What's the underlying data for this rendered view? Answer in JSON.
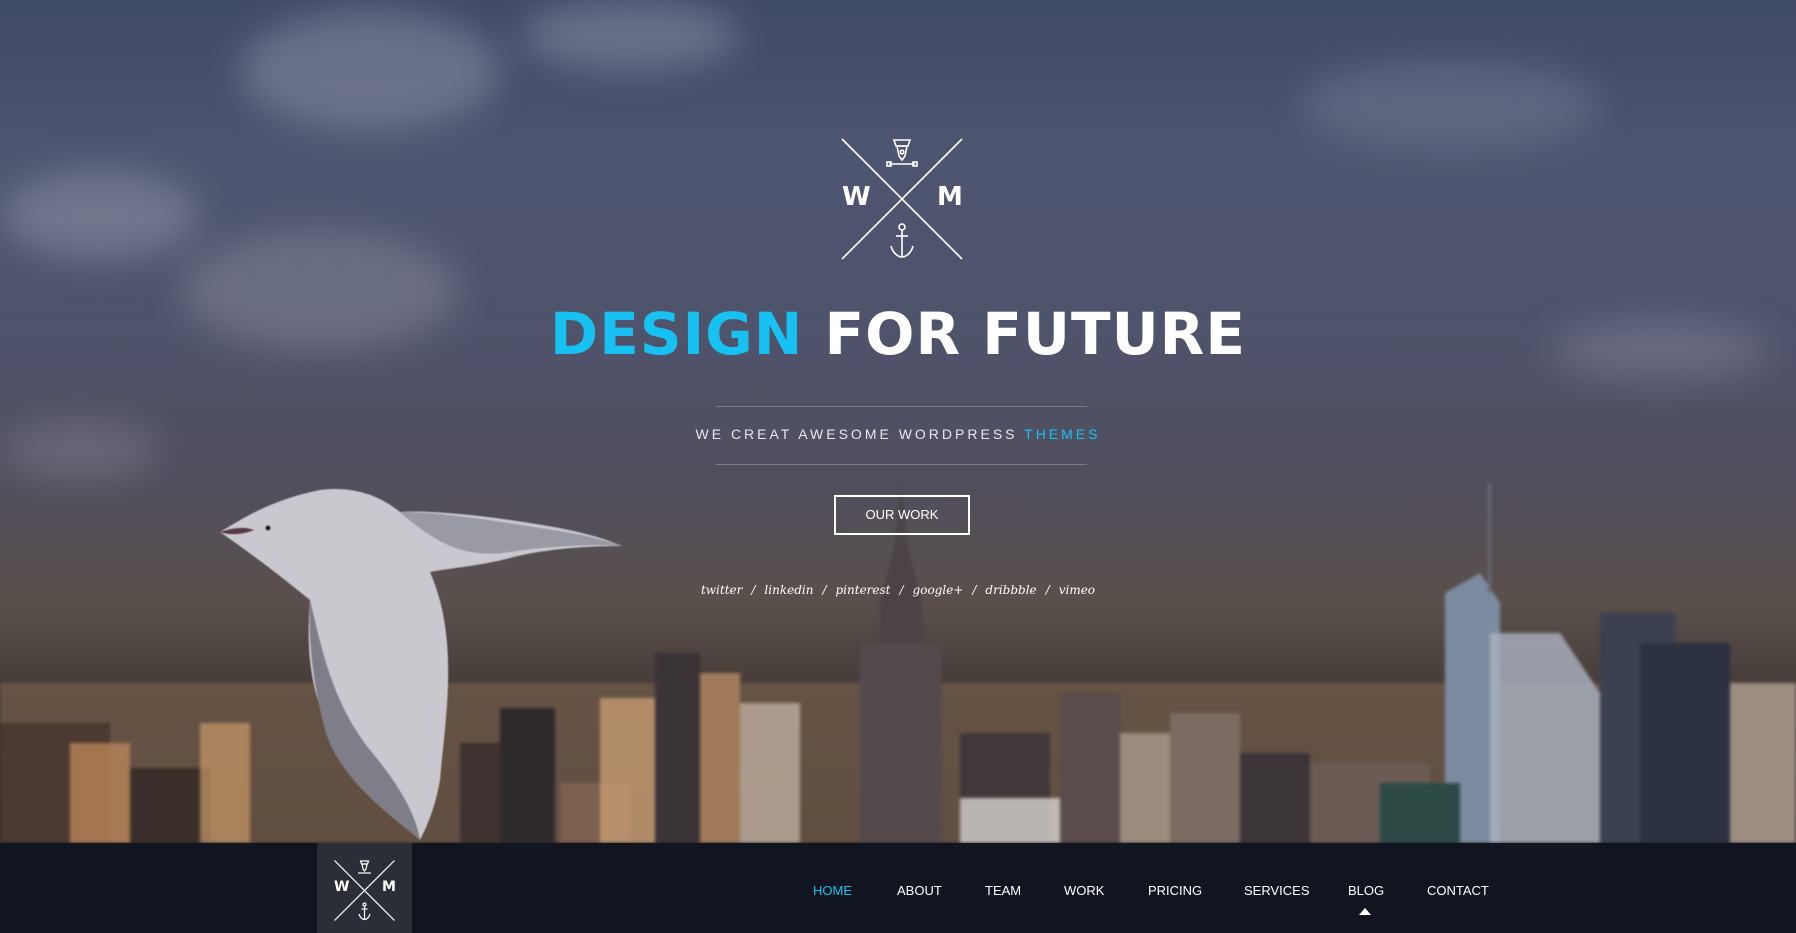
{
  "hero": {
    "logo_left": "W",
    "logo_right": "M",
    "headline_accent": "DESIGN",
    "headline_rest": "FOR FUTURE",
    "tagline_main": "WE CREAT AWESOME WORDPRESS",
    "tagline_accent": "THEMES",
    "cta_label": "OUR WORK",
    "accent_color": "#17c1f2"
  },
  "social": {
    "links": [
      "twitter",
      "linkedin",
      "pinterest",
      "google+",
      "dribbble",
      "vimeo"
    ],
    "separator": "/"
  },
  "nav": {
    "logo_left": "W",
    "logo_right": "M",
    "items": [
      "HOME",
      "ABOUT",
      "TEAM",
      "WORK",
      "PRICING",
      "SERVICES",
      "BLOG",
      "CONTACT"
    ],
    "active": "HOME",
    "hover": "BLOG"
  },
  "colors": {
    "accent": "#17c1f2",
    "navbar": "#111520",
    "nav_logo_bg": "#2b2e36"
  }
}
